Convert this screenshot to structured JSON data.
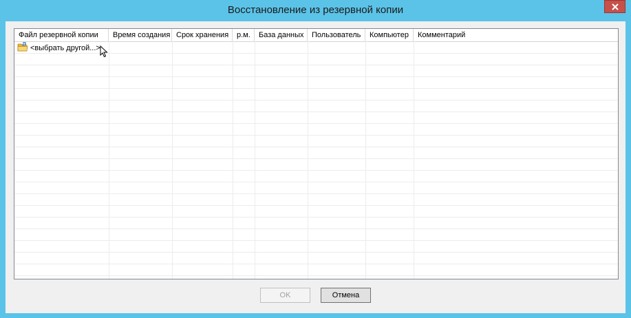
{
  "window": {
    "title": "Восстановление из резервной копии",
    "accent_color": "#5bc3e8",
    "close_icon": "close-icon"
  },
  "table": {
    "columns": [
      "Файл резервной копии",
      "Время создания",
      "Срок хранения",
      "р.м.",
      "База данных",
      "Пользователь",
      "Компьютер",
      "Комментарий"
    ],
    "rows": [
      {
        "icon": "folder-icon",
        "file": "<выбрать другой...>"
      }
    ]
  },
  "buttons": {
    "ok_label": "OK",
    "cancel_label": "Отмена"
  }
}
